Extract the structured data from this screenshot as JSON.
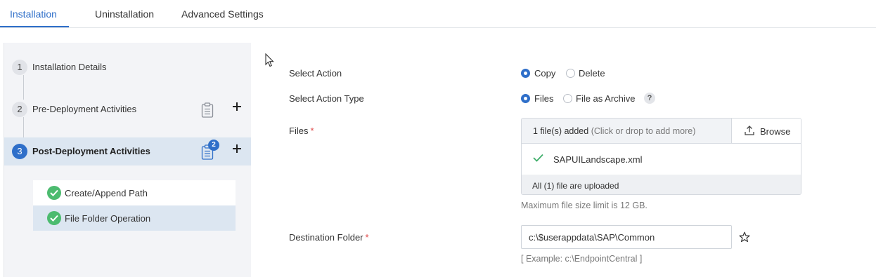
{
  "tabs": [
    {
      "label": "Installation",
      "active": true
    },
    {
      "label": "Uninstallation",
      "active": false
    },
    {
      "label": "Advanced Settings",
      "active": false
    }
  ],
  "steps": [
    {
      "number": "1",
      "label": "Installation Details"
    },
    {
      "number": "2",
      "label": "Pre-Deployment Activities",
      "icon": "clipboard-icon"
    },
    {
      "number": "3",
      "label": "Post-Deployment Activities",
      "icon": "clipboard-icon",
      "badge": "2",
      "active": true
    }
  ],
  "sub_items": [
    {
      "label": "Create/Append Path",
      "status": "completed"
    },
    {
      "label": "File Folder Operation",
      "status": "completed",
      "selected": true
    }
  ],
  "form": {
    "select_action": {
      "label": "Select Action",
      "options": [
        "Copy",
        "Delete"
      ],
      "selected": "Copy"
    },
    "select_action_type": {
      "label": "Select Action Type",
      "options": [
        "Files",
        "File as Archive"
      ],
      "selected": "Files",
      "help": "?"
    },
    "files": {
      "label": "Files",
      "required_mark": "*",
      "count_text": "1 file(s) added",
      "hint_text": "(Click or drop to add more)",
      "browse_label": "Browse",
      "items": [
        "SAPUILandscape.xml"
      ],
      "footer": "All (1) file are uploaded",
      "size_limit": "Maximum file size limit is 12 GB."
    },
    "destination": {
      "label": "Destination Folder",
      "required_mark": "*",
      "value": "c:\\$userappdata\\SAP\\Common",
      "example": "[ Example: c:\\EndpointCentral ]"
    }
  },
  "colors": {
    "accent": "#2f6fc9",
    "success": "#4cbb6f",
    "required": "#e04848",
    "active_step_bg": "#dce6f1",
    "panel_bg": "#f3f4f7"
  }
}
